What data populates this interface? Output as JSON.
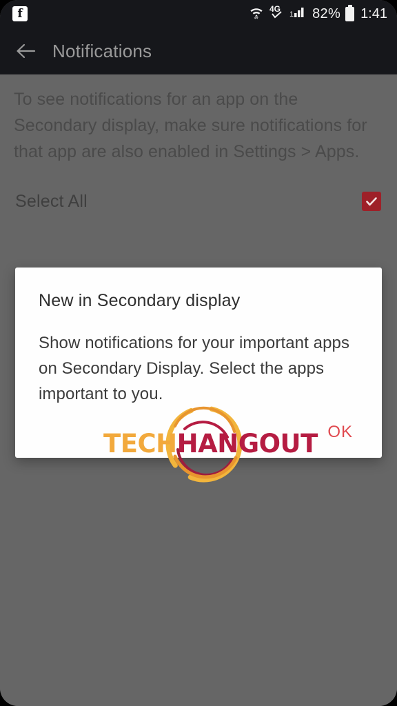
{
  "statusbar": {
    "app_icon": "facebook-icon",
    "wifi_icon": "wifi-with-data-arrows-icon",
    "network_label": "4G",
    "network_icon": "4g-checkmark-icon",
    "signal_icon": "cellular-signal-icon",
    "battery_percent": "82%",
    "battery_icon": "battery-full-icon",
    "time": "1:41"
  },
  "actionbar": {
    "back_icon": "back-arrow-icon",
    "title": "Notifications"
  },
  "page": {
    "description": "To see notifications for an app on the Secondary display, make sure notifications for that app are also enabled in Settings > Apps.",
    "select_all_label": "Select All",
    "select_all_checked": true,
    "checkbox_icon": "checkmark-icon"
  },
  "dialog": {
    "title": "New in Secondary display",
    "message": "Show notifications for your important apps on Secondary Display. Select the apps important to you.",
    "ok_label": "OK"
  },
  "watermark": {
    "text_part1": "TECH",
    "text_part2": "HANGOUT",
    "logo_icon": "techhangout-logo-icon"
  },
  "colors": {
    "statusbar_bg": "#16171b",
    "scrim": "#666666",
    "checkbox": "#9e2028",
    "ok_text": "#e0494f",
    "logo_amber": "#F2A93C",
    "logo_crimson": "#B51C42"
  }
}
